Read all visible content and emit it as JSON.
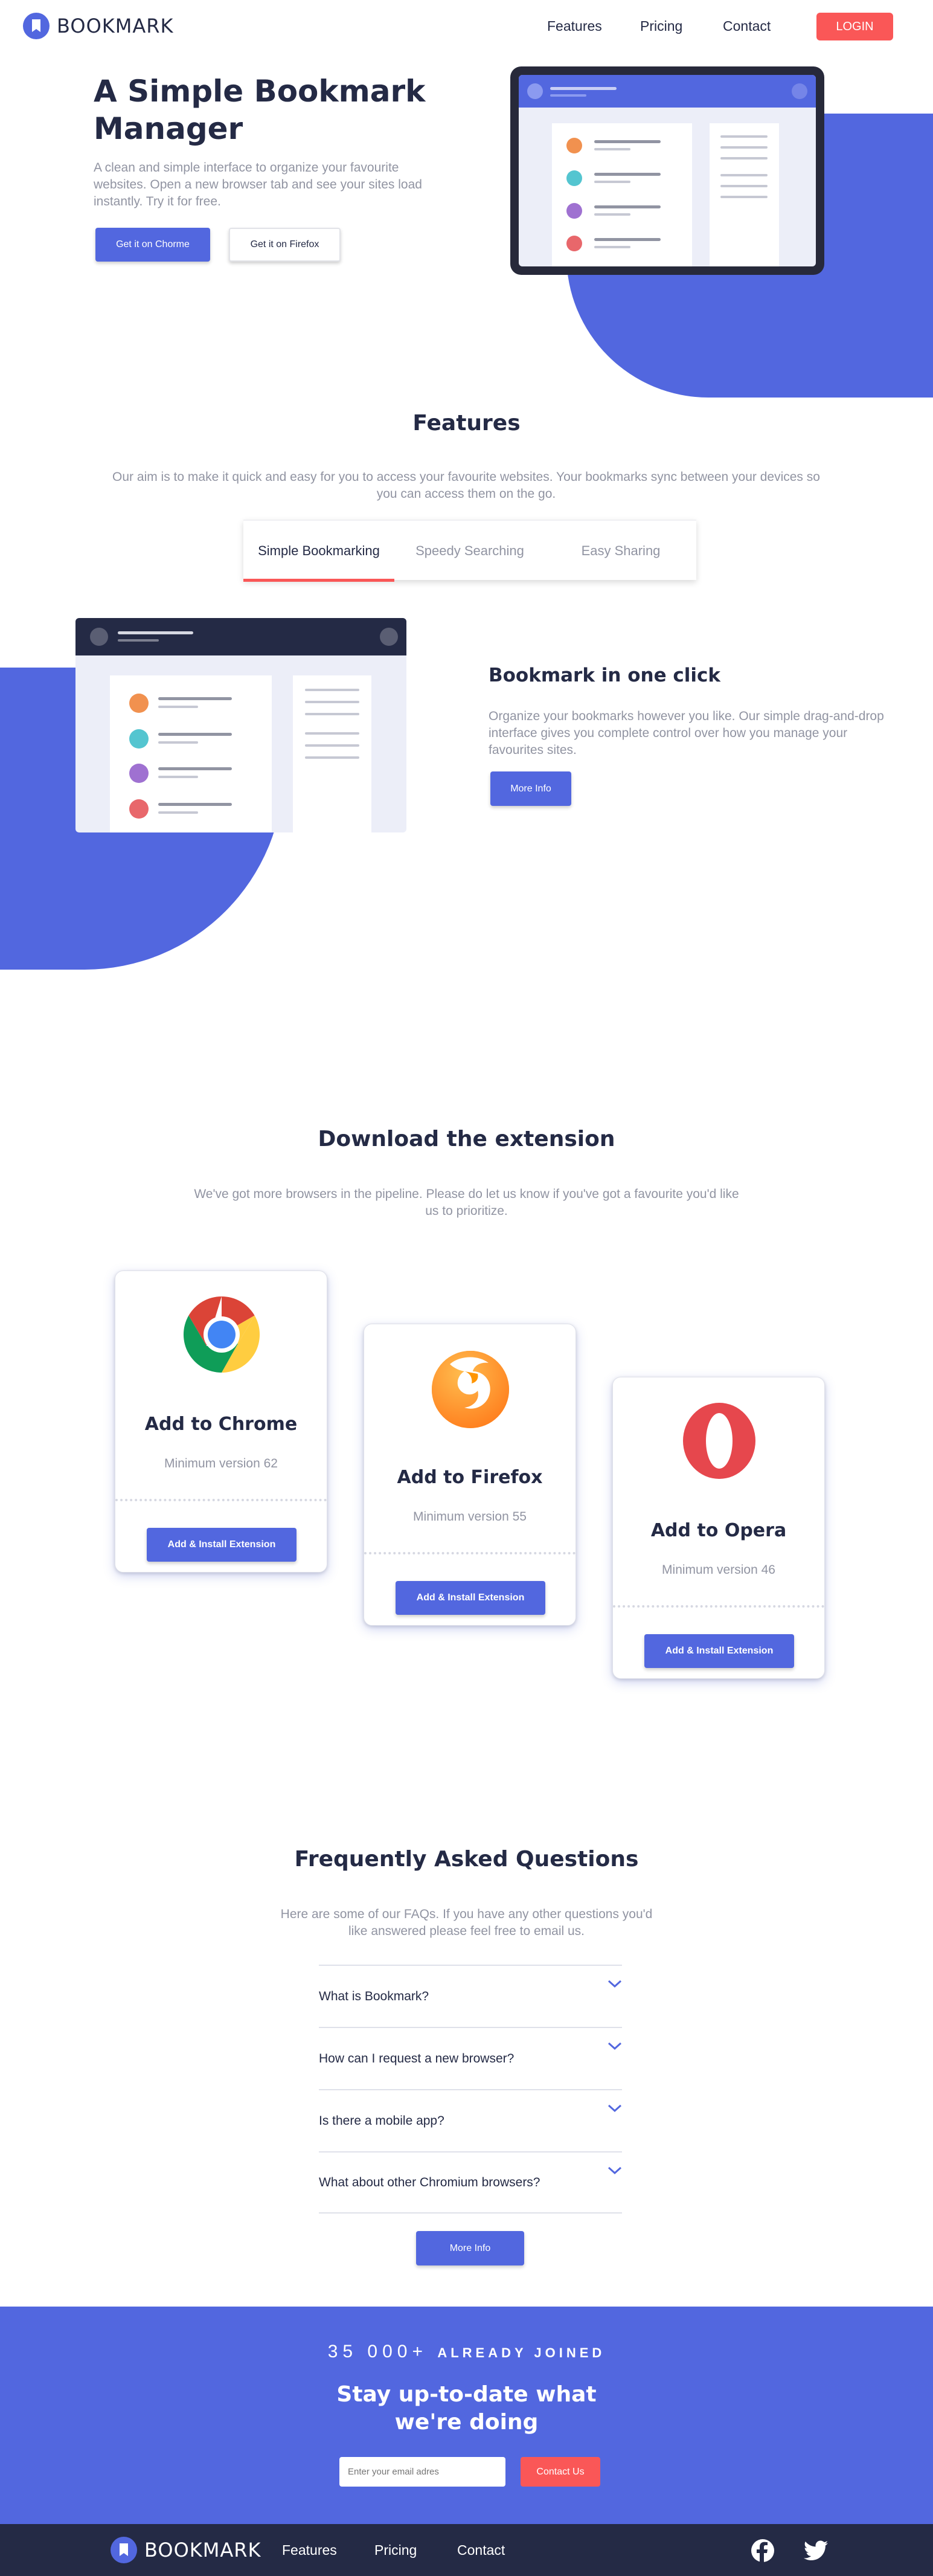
{
  "colors": {
    "primary": "#5267df",
    "accent_red": "#fa5757",
    "dark": "#242a45",
    "muted": "#9194a2"
  },
  "nav": {
    "logo_text": "BOOKMARK",
    "links": [
      "Features",
      "Pricing",
      "Contact"
    ],
    "login": "LOGIN"
  },
  "hero": {
    "title_line1": "A Simple Bookmark",
    "title_line2": "Manager",
    "subtitle": "A clean and simple interface to organize your favourite websites. Open a new browser tab and see your sites load instantly. Try it for free.",
    "chrome_btn": "Get it on Chorme",
    "firefox_btn": "Get it on Firefox"
  },
  "features": {
    "title": "Features",
    "subtitle": "Our aim is to make it quick and easy for you to access your favourite websites. Your bookmarks sync between your devices so you can access them on the go.",
    "tabs": [
      "Simple Bookmarking",
      "Speedy Searching",
      "Easy Sharing"
    ],
    "active_tab": 0,
    "panel_title": "Bookmark in one click",
    "panel_text": "Organize your bookmarks however you like. Our simple drag-and-drop interface gives you complete control over how you manage your favourites sites.",
    "more_info": "More Info"
  },
  "download": {
    "title": "Download the extension",
    "subtitle": "We've got more browsers in the pipeline. Please do let us know if you've got a favourite you'd like us to prioritize.",
    "cards": [
      {
        "title": "Add to Chrome",
        "min": "Minimum version 62",
        "button": "Add & Install Extension",
        "icon": "chrome-icon"
      },
      {
        "title": "Add to Firefox",
        "min": "Minimum version 55",
        "button": "Add & Install Extension",
        "icon": "firefox-icon"
      },
      {
        "title": "Add to Opera",
        "min": "Minimum version 46",
        "button": "Add & Install Extension",
        "icon": "opera-icon"
      }
    ]
  },
  "faq": {
    "title": "Frequently Asked Questions",
    "subtitle": "Here are some of our FAQs. If you have any other questions you'd like answered please feel free to email us.",
    "questions": [
      "What is Bookmark?",
      "How can I request a new browser?",
      "Is there a mobile app?",
      "What about other Chromium browsers?"
    ],
    "more_info": "More Info"
  },
  "cta": {
    "count": "35 000+",
    "count_suffix": "ALREADY JOINED",
    "title_line1": "Stay up-to-date what",
    "title_line2": "we're doing",
    "email_placeholder": "Enter your email adres",
    "button": "Contact Us"
  },
  "footer": {
    "logo_text": "BOOKMARK",
    "links": [
      "Features",
      "Pricing",
      "Contact"
    ],
    "social_icons": [
      "facebook-icon",
      "twitter-icon"
    ]
  }
}
